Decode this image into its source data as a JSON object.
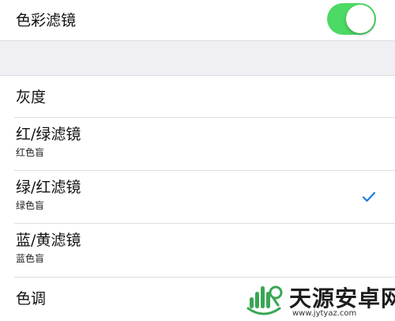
{
  "color_filters": {
    "label": "色彩滤镜",
    "enabled": true,
    "accent_color": "#4cd964"
  },
  "options": [
    {
      "title": "灰度",
      "subtitle": ""
    },
    {
      "title": "红/绿滤镜",
      "subtitle": "红色盲"
    },
    {
      "title": "绿/红滤镜",
      "subtitle": "绿色盲",
      "selected": true
    },
    {
      "title": "蓝/黄滤镜",
      "subtitle": "蓝色盲"
    },
    {
      "title": "色调",
      "subtitle": ""
    }
  ],
  "checkmark_color": "#1e7be4",
  "watermark": {
    "name": "天源安卓网",
    "url": "www.jytyaz.com"
  }
}
